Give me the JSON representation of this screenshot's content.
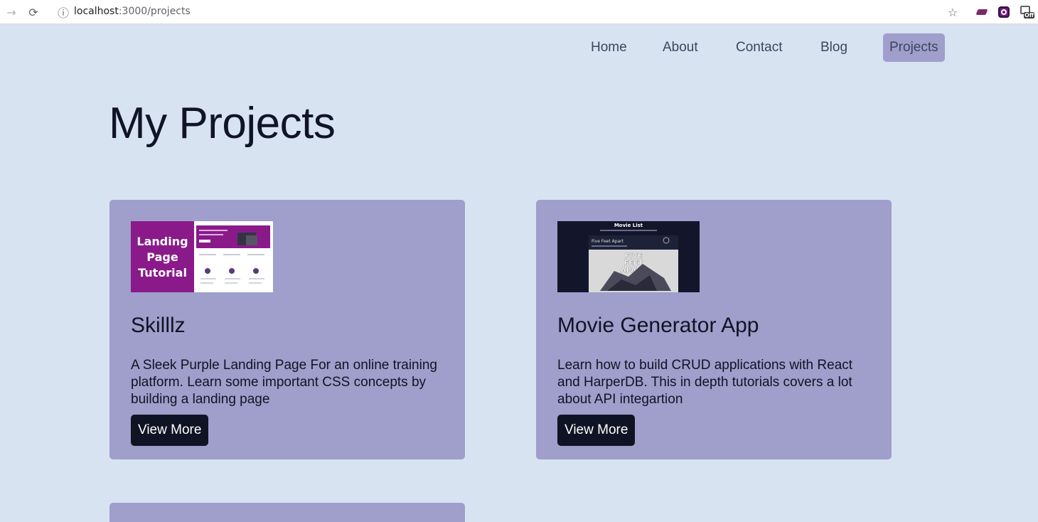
{
  "browser": {
    "url_host": "localhost",
    "url_path": ":3000/projects"
  },
  "nav": {
    "items": [
      {
        "label": "Home"
      },
      {
        "label": "About"
      },
      {
        "label": "Contact"
      },
      {
        "label": "Blog"
      },
      {
        "label": "Projects",
        "active": true
      }
    ]
  },
  "main": {
    "title": "My Projects",
    "projects": [
      {
        "thumb_text": [
          "Landing",
          "Page",
          "Tutorial"
        ],
        "title": "Skilllz",
        "description": "A Sleek Purple Landing Page For an online training platform. Learn some important CSS concepts by building a landing page",
        "button_label": "View More"
      },
      {
        "thumb_header": "Movie List",
        "thumb_subtitle": "Five Feet Apart",
        "thumb_poster_text": [
          "FIVE",
          "FEET",
          "APART"
        ],
        "title": "Movie Generator App",
        "description": "Learn how to build CRUD applications with React and HarperDB. This in depth tutorials covers a lot about API integartion",
        "button_label": "View More"
      }
    ]
  },
  "colors": {
    "background": "#d7e3f1",
    "card": "#a09ecb",
    "dark": "#0f1424",
    "thumb_purple": "#8a1a8a"
  }
}
